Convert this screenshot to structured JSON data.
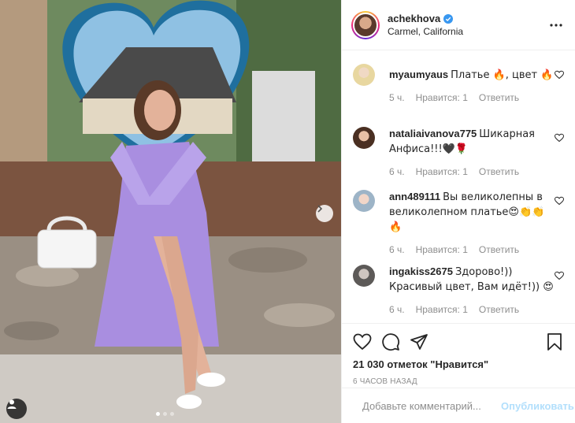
{
  "post": {
    "username": "achekhova",
    "location": "Carmel, California",
    "verified": true,
    "carousel": {
      "total": 3,
      "active_index": 1
    }
  },
  "comments": [
    {
      "username": "myaumyaus",
      "text": "Платье 🔥, цвет 🔥",
      "time": "5 ч.",
      "likes": "Нравится: 1",
      "reply": "Ответить"
    },
    {
      "username": "nataliaivanova775",
      "text": "Шикарная Анфиса!!!🖤🌹",
      "time": "6 ч.",
      "likes": "Нравится: 1",
      "reply": "Ответить"
    },
    {
      "username": "ann489111",
      "text": "Вы великолепны в великолепном платье😍👏👏🔥",
      "time": "6 ч.",
      "likes": "Нравится: 1",
      "reply": "Ответить"
    },
    {
      "username": "ingakiss2675",
      "text": "Здорово!)) Красивый цвет, Вам идёт!)) 😍",
      "time": "6 ч.",
      "likes": "Нравится: 1",
      "reply": "Ответить"
    }
  ],
  "stats": {
    "likes": "21 030 отметок \"Нравится\"",
    "time_ago": "6 часов назад"
  },
  "add_comment": {
    "placeholder": "Добавьте комментарий...",
    "publish": "Опубликовать"
  },
  "icons": {
    "more": "more-options-icon",
    "like": "heart-icon",
    "comment": "comment-bubble-icon",
    "share": "paper-plane-icon",
    "save": "bookmark-icon",
    "emoji": "smiley-icon",
    "next": "chevron-right-icon",
    "user_tag": "person-icon"
  },
  "colors": {
    "verified": "#3897f0",
    "publish_disabled": "#b2dffc",
    "meta_text": "#8e8e8e"
  }
}
